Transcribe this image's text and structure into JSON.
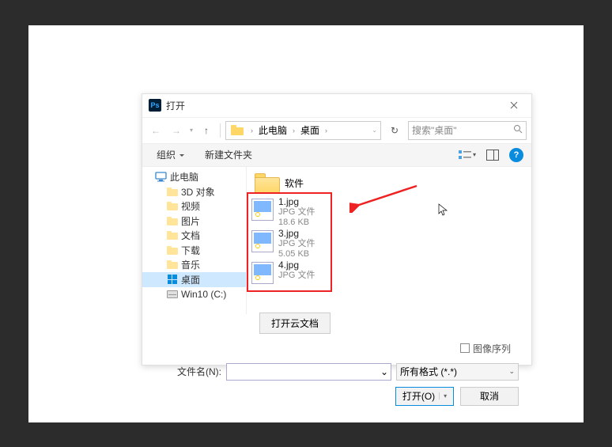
{
  "title": "打开",
  "nav": {
    "back": "←",
    "forward": "→",
    "up": "↑",
    "path": [
      "此电脑",
      "桌面"
    ],
    "refresh": "↻",
    "search_placeholder": "搜索\"桌面\""
  },
  "toolbar": {
    "organize": "组织",
    "new_folder": "新建文件夹"
  },
  "tree": [
    {
      "label": "此电脑",
      "type": "pc",
      "indent": 0
    },
    {
      "label": "3D 对象",
      "type": "folder",
      "indent": 1
    },
    {
      "label": "视频",
      "type": "folder",
      "indent": 1
    },
    {
      "label": "图片",
      "type": "folder",
      "indent": 1
    },
    {
      "label": "文档",
      "type": "folder",
      "indent": 1
    },
    {
      "label": "下载",
      "type": "folder",
      "indent": 1
    },
    {
      "label": "音乐",
      "type": "folder",
      "indent": 1
    },
    {
      "label": "桌面",
      "type": "folder",
      "indent": 1,
      "selected": true
    },
    {
      "label": "Win10 (C:)",
      "type": "disk",
      "indent": 1
    }
  ],
  "folder_item": "软件",
  "files": [
    {
      "name": "1.jpg",
      "type": "JPG 文件",
      "size": "18.6 KB"
    },
    {
      "name": "3.jpg",
      "type": "JPG 文件",
      "size": "5.05 KB"
    },
    {
      "name": "4.jpg",
      "type": "JPG 文件",
      "size": ""
    }
  ],
  "cloud_btn": "打开云文档",
  "checkbox_label": "图像序列",
  "filename_label": "文件名(N):",
  "filename_value": "",
  "filter_label": "所有格式 (*.*)",
  "open_btn": "打开(O)",
  "cancel_btn": "取消"
}
